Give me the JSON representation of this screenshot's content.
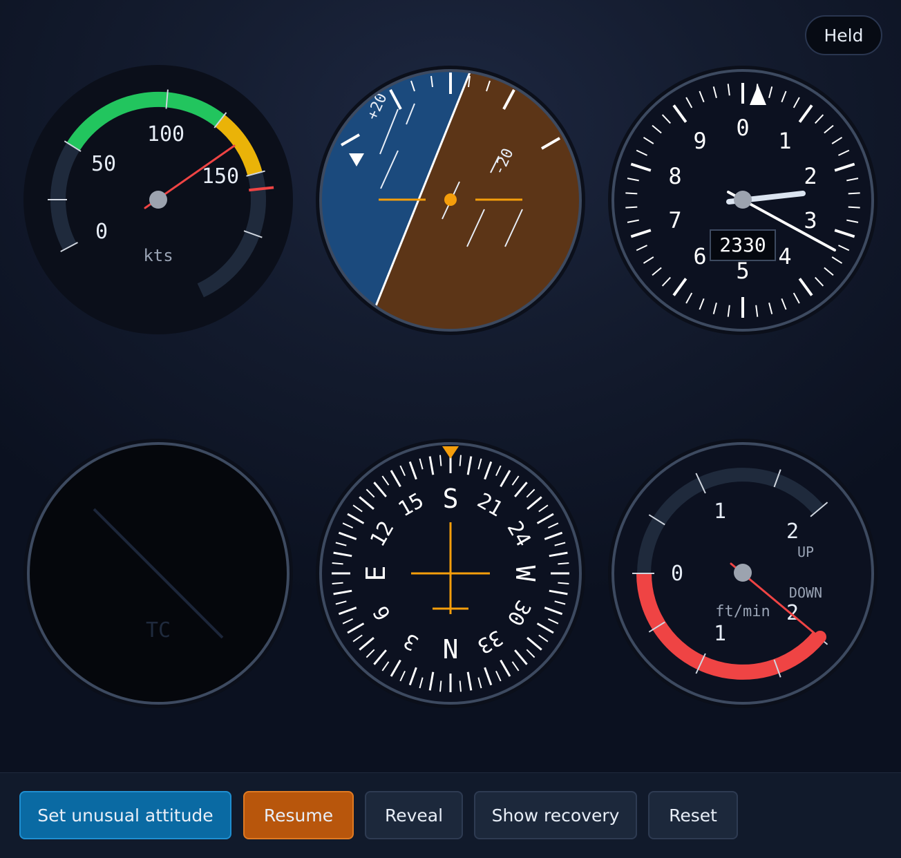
{
  "status": {
    "label": "Held"
  },
  "colors": {
    "sky": "#1b4a7d",
    "ground": "#5c3517",
    "accent": "#f59e0b",
    "green_arc": "#22c55e",
    "yellow_arc": "#eab308",
    "red": "#ef4444",
    "needle_white": "#ffffff",
    "hub": "#9ca3af",
    "bezel": "#3d4a60"
  },
  "airspeed": {
    "unit": "kts",
    "labels": [
      "0",
      "50",
      "100",
      "150"
    ],
    "value_kts": 157
  },
  "attitude": {
    "pitch_labels": [
      "+20",
      "-20"
    ],
    "bank_deg": 23
  },
  "altimeter": {
    "digits": [
      "0",
      "1",
      "2",
      "3",
      "4",
      "5",
      "6",
      "7",
      "8",
      "9"
    ],
    "readout": "2330"
  },
  "turn_coordinator": {
    "label": "TC"
  },
  "heading": {
    "labels": [
      "S",
      "21",
      "24",
      "W",
      "30",
      "33",
      "N",
      "3",
      "6",
      "E",
      "12",
      "15"
    ]
  },
  "vsi": {
    "unit": "ft/min",
    "labels": [
      "0",
      "1",
      "2",
      "1",
      "2"
    ],
    "up_label": "UP",
    "down_label": "DOWN"
  },
  "toolbar": {
    "set_unusual_label": "Set unusual attitude",
    "resume_label": "Resume",
    "reveal_label": "Reveal",
    "show_recovery_label": "Show recovery",
    "reset_label": "Reset"
  }
}
